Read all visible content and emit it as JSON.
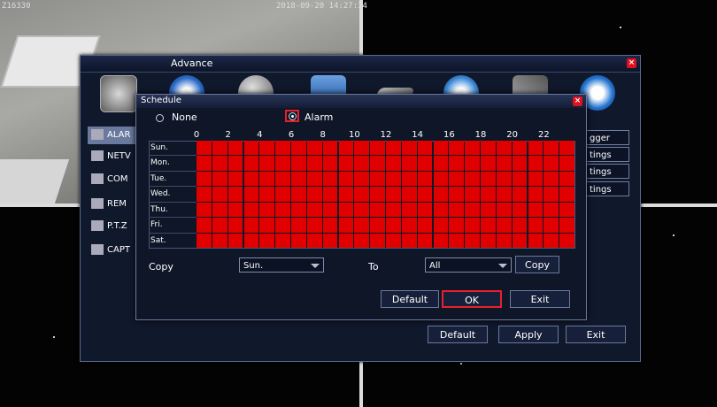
{
  "osd": {
    "channel": "Z16330",
    "timestamp": "2018-09-20 14:27:34"
  },
  "advance": {
    "title": "Advance",
    "sidebar": [
      "ALAR",
      "NETV",
      "COM",
      "REM",
      "P.T.Z",
      "CAPT"
    ],
    "right_buttons": [
      "gger",
      "tings",
      "tings",
      "tings"
    ],
    "footer": {
      "default": "Default",
      "apply": "Apply",
      "exit": "Exit"
    }
  },
  "schedule": {
    "title": "Schedule",
    "mode_none": "None",
    "mode_alarm": "Alarm",
    "selected_mode": "Alarm",
    "hours": [
      "0",
      "2",
      "4",
      "6",
      "8",
      "10",
      "12",
      "14",
      "16",
      "18",
      "20",
      "22"
    ],
    "days": [
      "Sun.",
      "Mon.",
      "Tue.",
      "Wed.",
      "Thu.",
      "Fri.",
      "Sat."
    ],
    "copy_label": "Copy",
    "copy_from": "Sun.",
    "to_label": "To",
    "copy_to": "All",
    "copy_button": "Copy",
    "default_button": "Default",
    "ok_button": "OK",
    "exit_button": "Exit",
    "grid_color": "#e00000",
    "highlight_color": "#e8202a"
  }
}
